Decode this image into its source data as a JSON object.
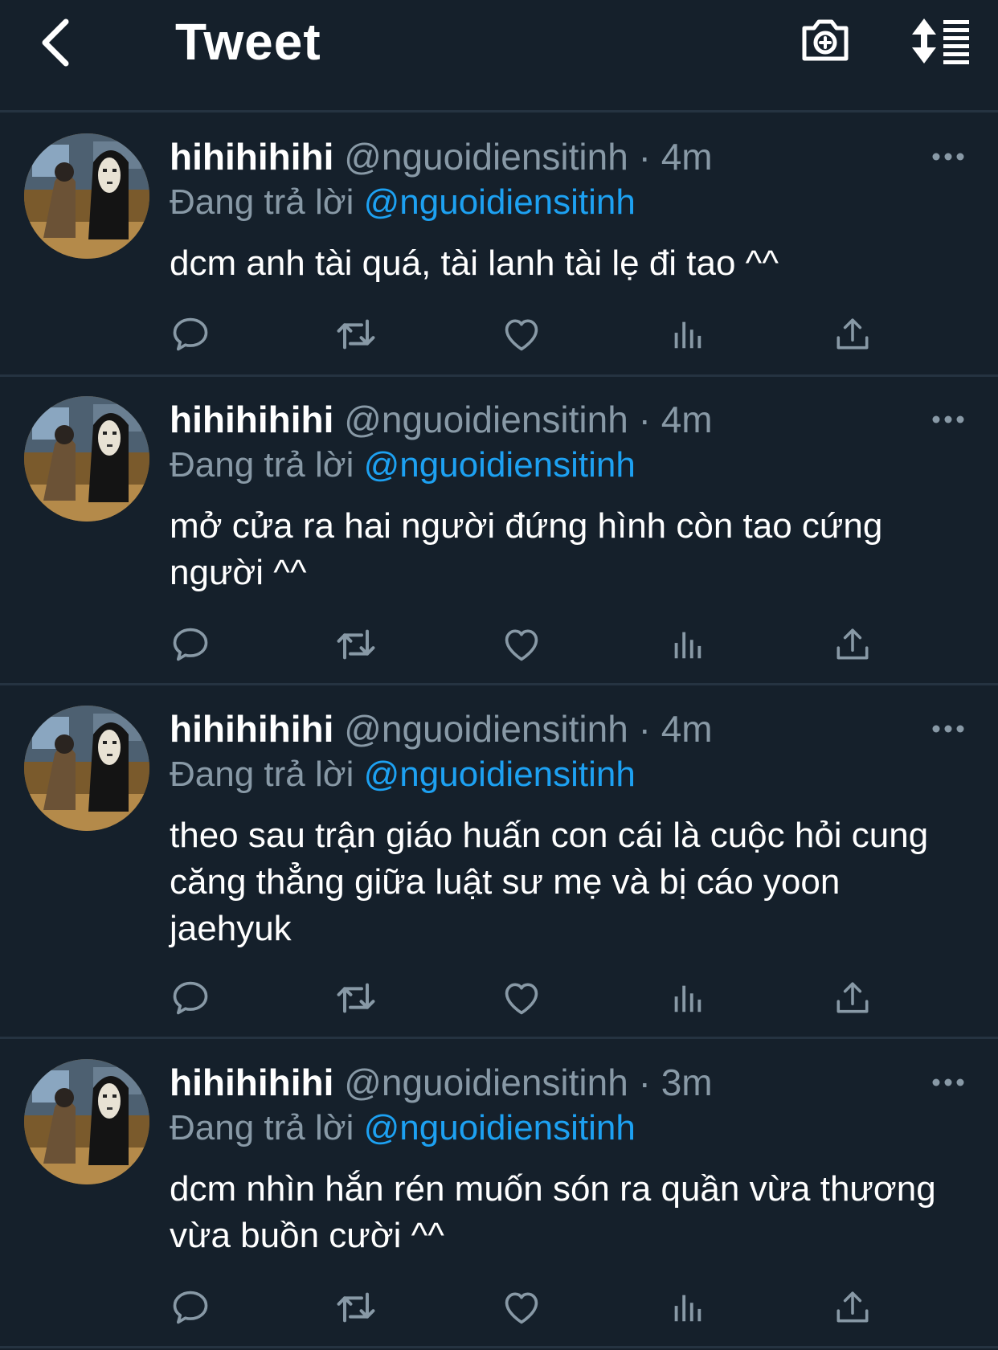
{
  "header": {
    "title": "Tweet",
    "back_icon": "chevron-left-icon",
    "camera_icon": "camera-plus-icon",
    "sort_icon": "sort-list-icon"
  },
  "colors": {
    "background": "#15202b",
    "divider": "#253341",
    "primary_text": "#ffffff",
    "secondary_text": "#8899a6",
    "accent": "#1da1f2"
  },
  "tweets": [
    {
      "display_name": "hihihihihi",
      "handle": "@nguoidiensitinh",
      "separator": "·",
      "time": "4m",
      "reply_prefix": "Đang trả lời",
      "reply_mention": "@nguoidiensitinh",
      "text": "dcm anh tài quá, tài lanh tài lẹ đi tao ^^"
    },
    {
      "display_name": "hihihihihi",
      "handle": "@nguoidiensitinh",
      "separator": "·",
      "time": "4m",
      "reply_prefix": "Đang trả lời",
      "reply_mention": "@nguoidiensitinh",
      "text": "mở cửa ra hai người đứng hình còn tao cứng người ^^"
    },
    {
      "display_name": "hihihihihi",
      "handle": "@nguoidiensitinh",
      "separator": "·",
      "time": "4m",
      "reply_prefix": "Đang trả lời",
      "reply_mention": "@nguoidiensitinh",
      "text": "theo sau trận giáo huấn con cái là cuộc hỏi cung căng thẳng giữa luật sư mẹ và bị cáo yoon jaehyuk"
    },
    {
      "display_name": "hihihihihi",
      "handle": "@nguoidiensitinh",
      "separator": "·",
      "time": "3m",
      "reply_prefix": "Đang trả lời",
      "reply_mention": "@nguoidiensitinh",
      "text": "dcm nhìn hắn rén muốn són ra quần vừa thương vừa buồn cười ^^"
    }
  ],
  "actions": {
    "reply_icon": "reply-icon",
    "retweet_icon": "retweet-icon",
    "like_icon": "heart-icon",
    "stats_icon": "analytics-icon",
    "share_icon": "share-icon",
    "more_icon": "more-dots-icon"
  }
}
